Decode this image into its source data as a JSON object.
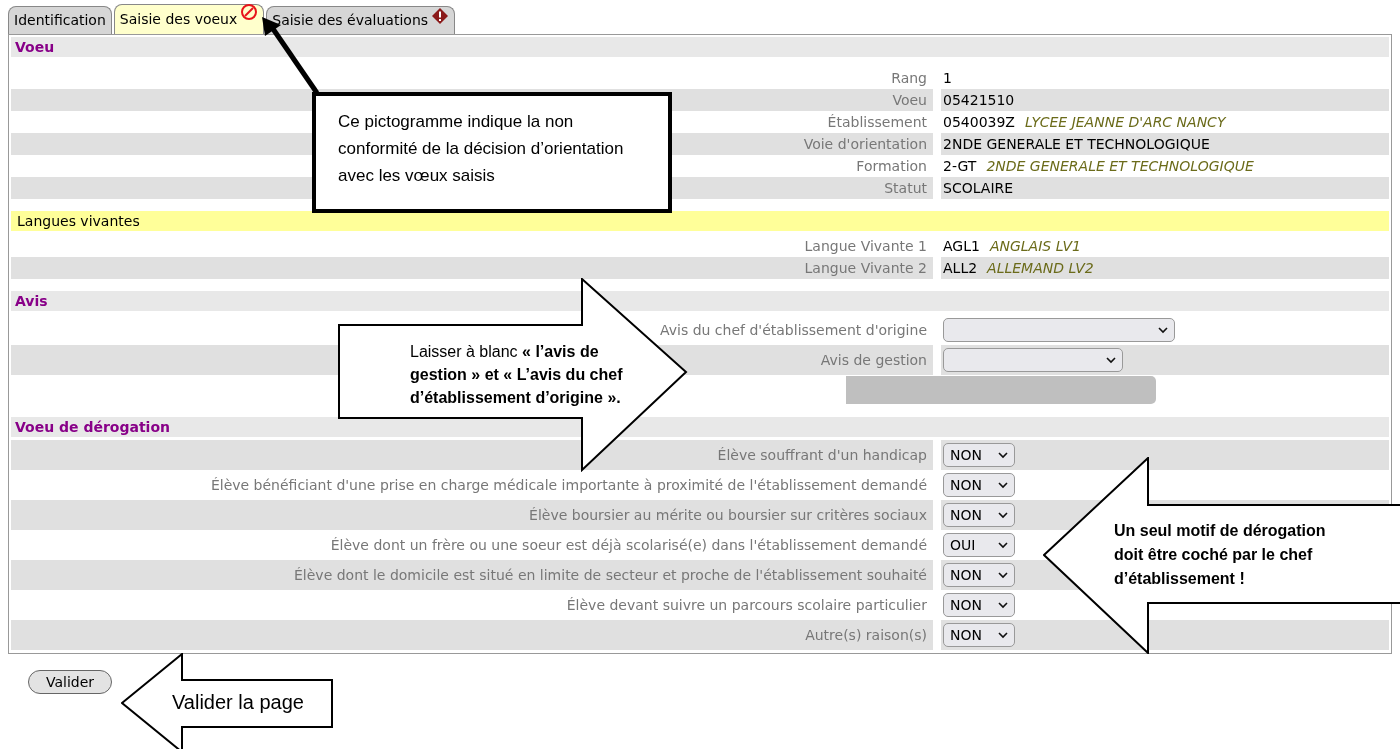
{
  "tabs": [
    {
      "label": "Identification",
      "selected": false
    },
    {
      "label": "Saisie des voeux",
      "selected": true
    },
    {
      "label": "Saisie des évaluations",
      "selected": false
    }
  ],
  "sections": [
    {
      "title": "Voeu",
      "kind": "info",
      "rows": [
        {
          "label": "Rang",
          "code": "1"
        },
        {
          "label": "Voeu",
          "code": "05421510"
        },
        {
          "label": "Établissement",
          "code": "0540039Z",
          "name": "LYCEE JEANNE D'ARC NANCY"
        },
        {
          "label": "Voie d'orientation",
          "code": "2NDE GENERALE ET TECHNOLOGIQUE"
        },
        {
          "label": "Formation",
          "code": "2-GT",
          "name": "2NDE GENERALE ET TECHNOLOGIQUE"
        },
        {
          "label": "Statut",
          "code": "SCOLAIRE"
        }
      ]
    },
    {
      "title": "Langues vivantes",
      "kind": "highlight",
      "rows": [
        {
          "label": "Langue Vivante 1",
          "code": "AGL1",
          "name": "ANGLAIS LV1"
        },
        {
          "label": "Langue Vivante 2",
          "code": "ALL2",
          "name": "ALLEMAND LV2"
        }
      ]
    },
    {
      "title": "Avis",
      "kind": "opinion",
      "rows": [
        {
          "kind": "select",
          "label": "Avis du chef d'établissement d'origine"
        },
        {
          "kind": "select",
          "label": "Avis de gestion"
        },
        {
          "kind": "redacted"
        }
      ]
    },
    {
      "title": "Voeu de dérogation",
      "kind": "derogation",
      "rows": [
        {
          "kind": "select",
          "label": "Élève souffrant d'un handicap",
          "value": "NON"
        },
        {
          "kind": "select",
          "label": "Élève bénéficiant d'une prise en charge médicale importante à proximité de l'établissement demandé",
          "value": "NON"
        },
        {
          "kind": "select",
          "label": "Élève boursier au mérite ou boursier sur critères sociaux",
          "value": "NON"
        },
        {
          "kind": "select",
          "label": "Élève dont un frère ou une soeur est déjà scolarisé(e) dans l'établissement demandé",
          "value": "OUI"
        },
        {
          "kind": "select",
          "label": "Élève dont le domicile est situé en limite de secteur et proche de l'établissement souhaité",
          "value": "NON"
        },
        {
          "kind": "select",
          "label": "Élève devant suivre un parcours scolaire particulier",
          "value": "NON"
        },
        {
          "kind": "select",
          "label": "Autre(s) raison(s)",
          "value": "NON"
        }
      ]
    }
  ],
  "submit_button": "Valider",
  "annotations": [
    {
      "kind": "box",
      "text": "Ce pictogramme indique la non conformité de la décision d’orientation avec les vœux saisis"
    },
    {
      "kind": "arrow-right",
      "text": "Laisser à blanc **« l’avis de gestion » et « L’avis du chef d’établissement d’origine ».**"
    },
    {
      "kind": "arrow-left",
      "text": "Un seul motif de dérogation doit être coché par le chef d’établissement !"
    },
    {
      "kind": "arrow-left-small",
      "text": "Valider la page"
    }
  ]
}
